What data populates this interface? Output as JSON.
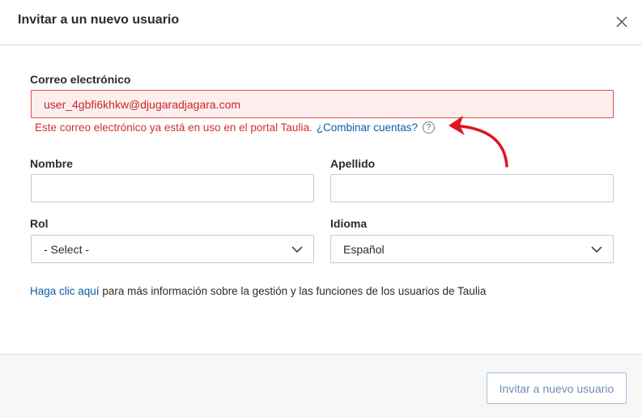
{
  "dialog": {
    "title": "Invitar a un nuevo usuario"
  },
  "email": {
    "label": "Correo electrónico",
    "value": "user_4gbfi6khkw@djugaradjagara.com",
    "error_text": "Este correo electrónico ya está en uso en el portal Taulia.",
    "merge_link": "¿Combinar cuentas?",
    "help_glyph": "?"
  },
  "first_name": {
    "label": "Nombre",
    "value": ""
  },
  "last_name": {
    "label": "Apellido",
    "value": ""
  },
  "role": {
    "label": "Rol",
    "selected": "- Select -"
  },
  "language": {
    "label": "Idioma",
    "selected": "Español"
  },
  "info": {
    "link": "Haga clic aquí",
    "text": " para más información sobre la gestión y las funciones de los usuarios de Taulia"
  },
  "footer": {
    "invite_label": "Invitar a nuevo usuario"
  },
  "colors": {
    "error": "#d32f2f",
    "link": "#0a5ea8",
    "annotation_arrow": "#e0141e"
  }
}
